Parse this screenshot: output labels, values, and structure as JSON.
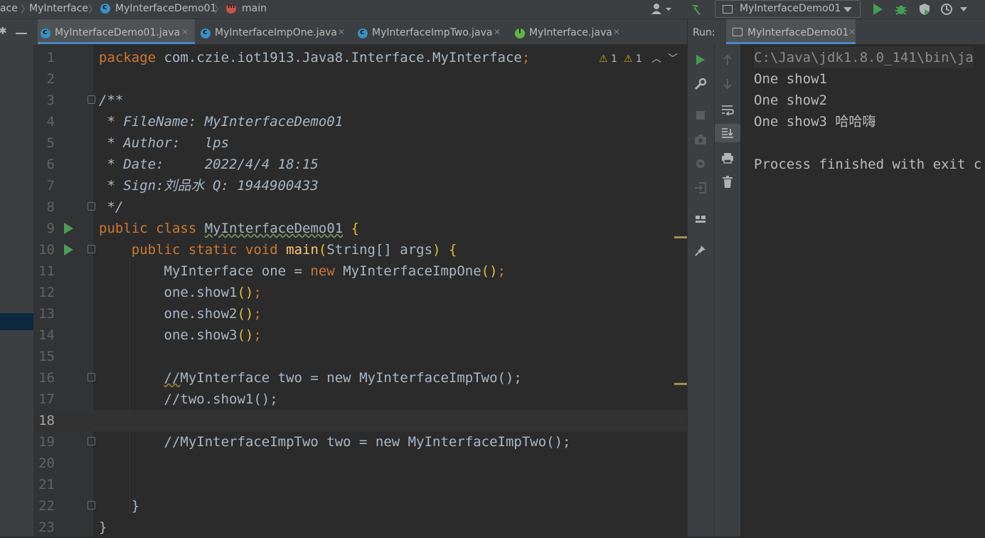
{
  "breadcrumb": {
    "items": [
      "ace",
      "MyInterface",
      "MyInterfaceDemo01",
      "main"
    ]
  },
  "toolbar": {
    "run_config": "MyInterfaceDemo01"
  },
  "tabs": [
    {
      "label": "MyInterfaceDemo01.java",
      "icon": "class-icon",
      "active": true
    },
    {
      "label": "MyInterfaceImpOne.java",
      "icon": "class-icon",
      "active": false
    },
    {
      "label": "MyInterfaceImpTwo.java",
      "icon": "class-icon",
      "active": false
    },
    {
      "label": "MyInterface.java",
      "icon": "interface-icon",
      "active": false
    }
  ],
  "inspections": {
    "warnings": "1",
    "weak_warnings": "1"
  },
  "code": {
    "line_numbers": [
      "1",
      "2",
      "3",
      "4",
      "5",
      "6",
      "7",
      "8",
      "9",
      "10",
      "11",
      "12",
      "13",
      "14",
      "15",
      "16",
      "17",
      "18",
      "19",
      "20",
      "21",
      "22",
      "23"
    ],
    "l1_kw": "package",
    "l1_pkg": "com.czie.iot1913.Java8.Interface.MyInterface",
    "l1_semi": ";",
    "l3": "/**",
    "l4": " * FileName: MyInterfaceDemo01",
    "l5": " * Author:   lps",
    "l6": " * Date:     2022/4/4 18:15",
    "l7": " * Sign:刘品水 Q: 1944900433",
    "l8": " */",
    "l9_kw": "public class",
    "l9_name": "MyInterfaceDemo01",
    "l9_brace": "{",
    "l10_kw": "public static void",
    "l10_fn": "main",
    "l10_paren_open": "(",
    "l10_args": "String[] args",
    "l10_paren_close": ")",
    "l10_brace": "{",
    "l11_type": "MyInterface one = ",
    "l11_new": "new",
    "l11_ctor": "MyInterfaceImpOne",
    "l11_parens": "()",
    "l11_semi": ";",
    "l12": "one.show1",
    "l13": "one.show2",
    "l14": "one.show3",
    "call_parens": "()",
    "call_semi": ";",
    "l16_a": "//",
    "l16_b": "MyInterface two = new MyInterfaceImpTwo();",
    "l17": "//two.show1();",
    "l19": "//MyInterfaceImpTwo two = new MyInterfaceImpTwo();",
    "l22": "}",
    "l23": "}"
  },
  "run": {
    "label": "Run:",
    "tab": "MyInterfaceDemo01",
    "console": [
      "C:\\Java\\jdk1.8.0_141\\bin\\ja",
      "One show1",
      "One show2",
      "One show3 哈哈嗨",
      "",
      "Process finished with exit c"
    ]
  },
  "colors": {
    "keyword": "#cc7832",
    "doc_comment": "#629755",
    "comment": "#808080",
    "method": "#ffc66d",
    "run_green": "#499c54"
  }
}
